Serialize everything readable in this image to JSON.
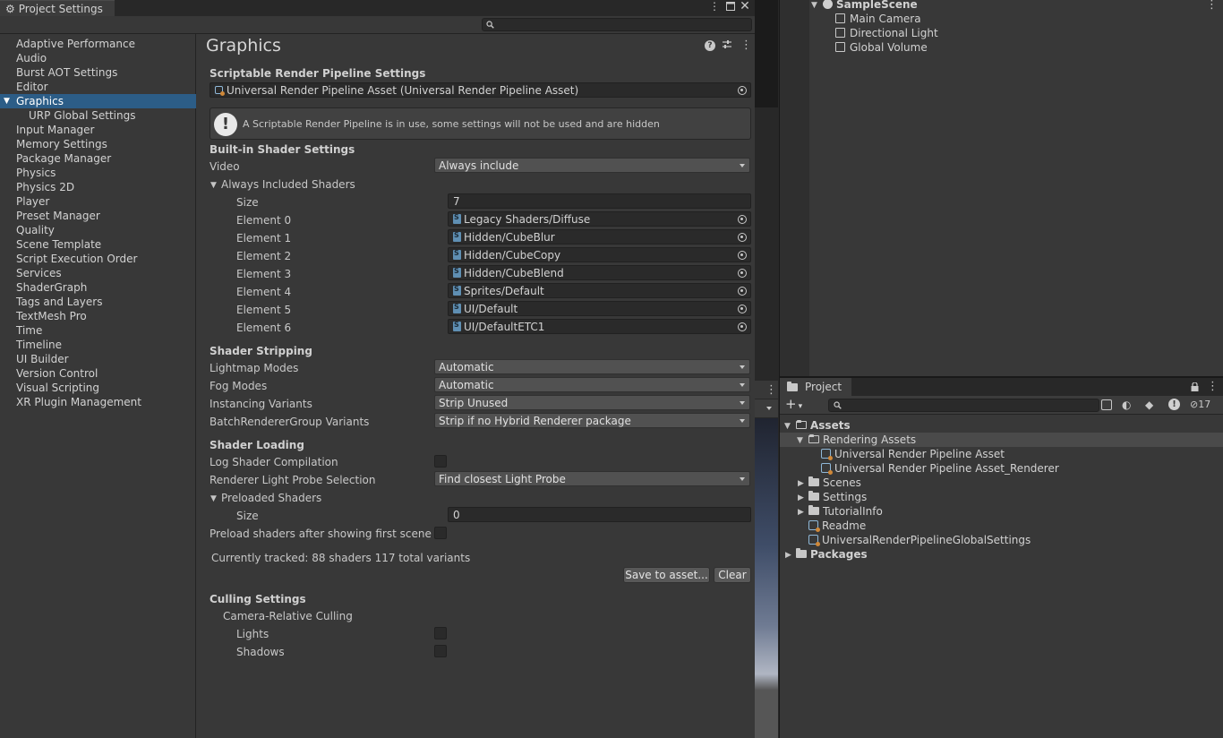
{
  "window": {
    "title": "Project Settings",
    "menu_icon": "kebab-icon",
    "maximize_icon": "maximize-icon",
    "close_icon": "close-icon"
  },
  "sidebar": {
    "items": [
      {
        "label": "Adaptive Performance"
      },
      {
        "label": "Audio"
      },
      {
        "label": "Burst AOT Settings"
      },
      {
        "label": "Editor"
      },
      {
        "label": "Graphics",
        "selected": true
      },
      {
        "label": "URP Global Settings",
        "sub": true
      },
      {
        "label": "Input Manager"
      },
      {
        "label": "Memory Settings"
      },
      {
        "label": "Package Manager"
      },
      {
        "label": "Physics"
      },
      {
        "label": "Physics 2D"
      },
      {
        "label": "Player"
      },
      {
        "label": "Preset Manager"
      },
      {
        "label": "Quality"
      },
      {
        "label": "Scene Template"
      },
      {
        "label": "Script Execution Order"
      },
      {
        "label": "Services"
      },
      {
        "label": "ShaderGraph"
      },
      {
        "label": "Tags and Layers"
      },
      {
        "label": "TextMesh Pro"
      },
      {
        "label": "Time"
      },
      {
        "label": "Timeline"
      },
      {
        "label": "UI Builder"
      },
      {
        "label": "Version Control"
      },
      {
        "label": "Visual Scripting"
      },
      {
        "label": "XR Plugin Management"
      }
    ]
  },
  "graphics": {
    "title": "Graphics",
    "srp_section": "Scriptable Render Pipeline Settings",
    "srp_asset": "Universal Render Pipeline Asset (Universal Render Pipeline Asset)",
    "srp_info": "A Scriptable Render Pipeline is in use, some settings will not be used and are hidden",
    "builtin_section": "Built-in Shader Settings",
    "video_label": "Video",
    "video_value": "Always include",
    "always_included_label": "Always Included Shaders",
    "size_label": "Size",
    "size_value": "7",
    "elements": [
      {
        "label": "Element 0",
        "value": "Legacy Shaders/Diffuse"
      },
      {
        "label": "Element 1",
        "value": "Hidden/CubeBlur"
      },
      {
        "label": "Element 2",
        "value": "Hidden/CubeCopy"
      },
      {
        "label": "Element 3",
        "value": "Hidden/CubeBlend"
      },
      {
        "label": "Element 4",
        "value": "Sprites/Default"
      },
      {
        "label": "Element 5",
        "value": "UI/Default"
      },
      {
        "label": "Element 6",
        "value": "UI/DefaultETC1"
      }
    ],
    "stripping_section": "Shader Stripping",
    "stripping": [
      {
        "label": "Lightmap Modes",
        "value": "Automatic"
      },
      {
        "label": "Fog Modes",
        "value": "Automatic"
      },
      {
        "label": "Instancing Variants",
        "value": "Strip Unused"
      },
      {
        "label": "BatchRendererGroup Variants",
        "value": "Strip if no Hybrid Renderer package"
      }
    ],
    "loading_section": "Shader Loading",
    "log_compilation_label": "Log Shader Compilation",
    "light_probe_label": "Renderer Light Probe Selection",
    "light_probe_value": "Find closest Light Probe",
    "preloaded_label": "Preloaded Shaders",
    "preloaded_size_label": "Size",
    "preloaded_size_value": "0",
    "preload_after_label": "Preload shaders after showing first scene",
    "tracked_text": "Currently tracked: 88 shaders 117 total variants",
    "save_button": "Save to asset...",
    "clear_button": "Clear",
    "culling_section": "Culling Settings",
    "camera_relative_label": "Camera-Relative Culling",
    "lights_label": "Lights",
    "shadows_label": "Shadows"
  },
  "hierarchy": {
    "scene_name": "SampleScene",
    "objects": [
      {
        "label": "Main Camera"
      },
      {
        "label": "Directional Light"
      },
      {
        "label": "Global Volume"
      }
    ]
  },
  "project": {
    "tab_label": "Project",
    "hidden_count": "17",
    "tree": [
      {
        "label": "Assets",
        "type": "folder-open",
        "level": 0,
        "bold": true
      },
      {
        "label": "Rendering Assets",
        "type": "folder-open",
        "level": 1,
        "selected": true
      },
      {
        "label": "Universal Render Pipeline Asset",
        "type": "asset",
        "level": 2
      },
      {
        "label": "Universal Render Pipeline Asset_Renderer",
        "type": "asset",
        "level": 2
      },
      {
        "label": "Scenes",
        "type": "folder",
        "level": 1
      },
      {
        "label": "Settings",
        "type": "folder",
        "level": 1
      },
      {
        "label": "TutorialInfo",
        "type": "folder",
        "level": 1
      },
      {
        "label": "Readme",
        "type": "asset",
        "level": 1
      },
      {
        "label": "UniversalRenderPipelineGlobalSettings",
        "type": "asset",
        "level": 1
      },
      {
        "label": "Packages",
        "type": "folder",
        "level": 0,
        "bold": true
      }
    ]
  }
}
